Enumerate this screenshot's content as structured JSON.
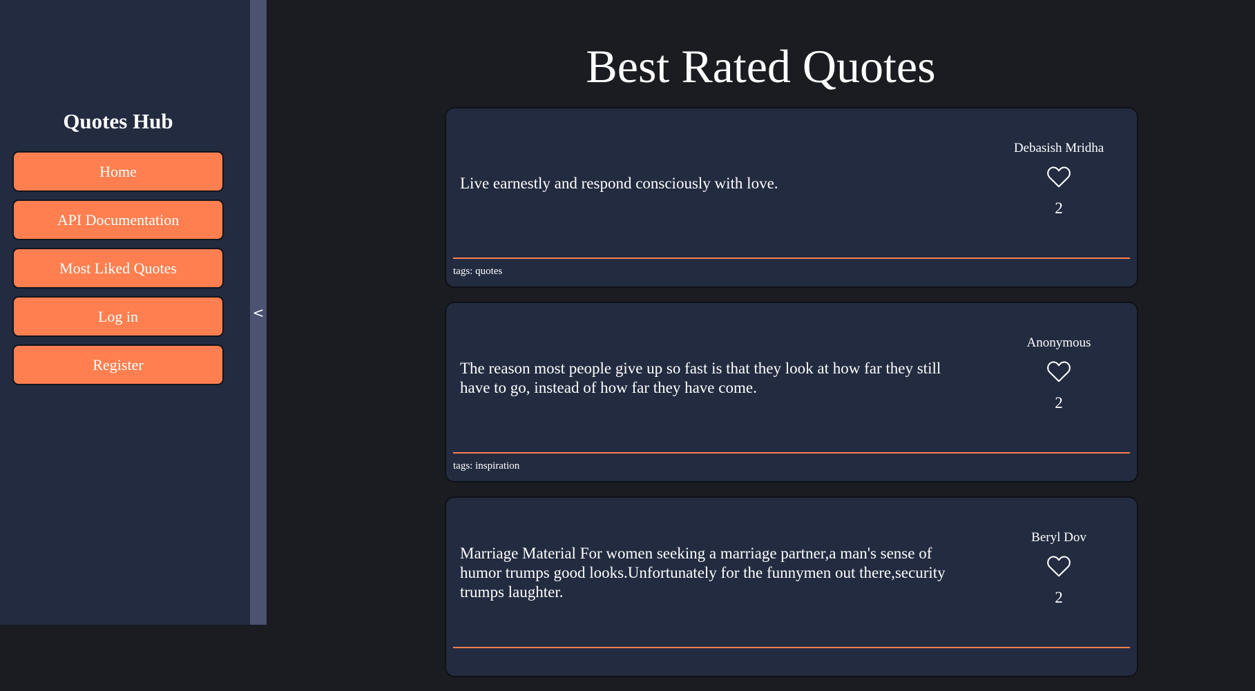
{
  "sidebar": {
    "title": "Quotes Hub",
    "nav": [
      {
        "label": "Home"
      },
      {
        "label": "API Documentation"
      },
      {
        "label": "Most Liked Quotes"
      },
      {
        "label": "Log in"
      },
      {
        "label": "Register"
      }
    ],
    "collapse_glyph": "<"
  },
  "page": {
    "title": "Best Rated Quotes"
  },
  "quotes": [
    {
      "text": "Live earnestly and respond consciously with love.",
      "author": "Debasish Mridha",
      "likes": "2",
      "tags": "tags: quotes",
      "like_icon": "heart-outline-icon"
    },
    {
      "text": "The reason most people give up so fast is that they look at how far they still have to go, instead of how far they have come.",
      "author": "Anonymous",
      "likes": "2",
      "tags": "tags: inspiration",
      "like_icon": "heart-outline-icon"
    },
    {
      "text": "Marriage Material For women seeking a marriage partner,a man's sense of humor trumps good looks.Unfortunately for the funnymen out there,security trumps laughter.",
      "author": "Beryl Dov",
      "likes": "2",
      "tags": "",
      "like_icon": "heart-outline-icon"
    }
  ],
  "colors": {
    "accent": "#ff7f50",
    "sidebar_bg": "#222b40",
    "page_bg": "#1a1c22",
    "card_bg": "#222b40",
    "handle_bg": "#4b5272"
  }
}
